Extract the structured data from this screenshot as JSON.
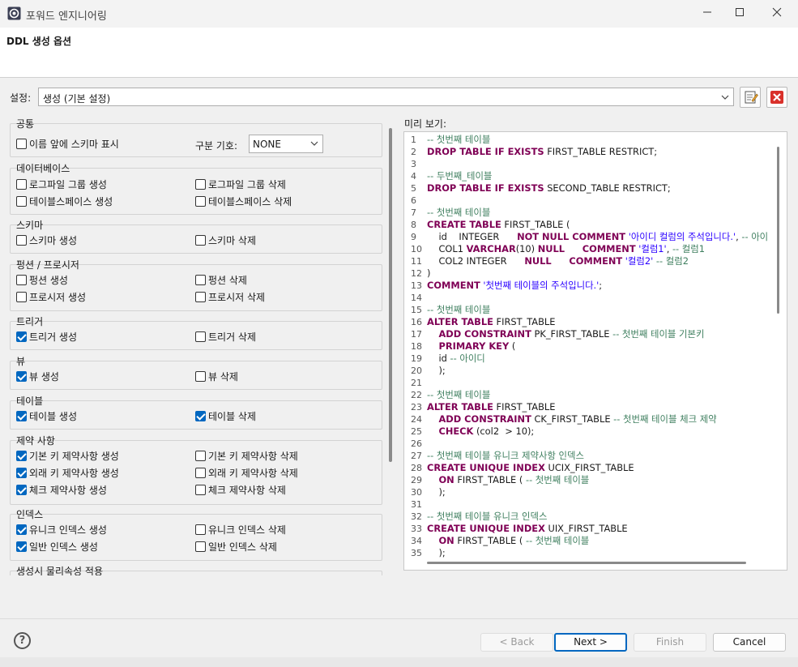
{
  "window": {
    "title": "포워드 엔지니어링",
    "minimize": "—",
    "maximize": "☐",
    "close": "✕"
  },
  "header": {
    "title": "DDL 생성 옵션"
  },
  "setting": {
    "label": "설정:",
    "value": "생성 (기본 설정)"
  },
  "options": {
    "common": {
      "title": "공통",
      "show_schema": "이름 앞에 스키마 표시",
      "show_schema_checked": false,
      "separator_label": "구분 기호:",
      "separator_value": "NONE"
    },
    "database": {
      "title": "데이터베이스",
      "items": [
        {
          "label": "로그파일 그룹 생성",
          "checked": false
        },
        {
          "label": "로그파일 그룹 삭제",
          "checked": false
        },
        {
          "label": "테이블스페이스 생성",
          "checked": false
        },
        {
          "label": "테이블스페이스 삭제",
          "checked": false
        }
      ]
    },
    "schema": {
      "title": "스키마",
      "items": [
        {
          "label": "스키마 생성",
          "checked": false
        },
        {
          "label": "스키마 삭제",
          "checked": false
        }
      ]
    },
    "function": {
      "title": "펑션 / 프로시저",
      "items": [
        {
          "label": "펑션 생성",
          "checked": false
        },
        {
          "label": "펑션 삭제",
          "checked": false
        },
        {
          "label": "프로시저 생성",
          "checked": false
        },
        {
          "label": "프로시저 삭제",
          "checked": false
        }
      ]
    },
    "trigger": {
      "title": "트리거",
      "items": [
        {
          "label": "트리거 생성",
          "checked": true
        },
        {
          "label": "트리거 삭제",
          "checked": false
        }
      ]
    },
    "view": {
      "title": "뷰",
      "items": [
        {
          "label": "뷰 생성",
          "checked": true
        },
        {
          "label": "뷰 삭제",
          "checked": false
        }
      ]
    },
    "table": {
      "title": "테이블",
      "items": [
        {
          "label": "테이블 생성",
          "checked": true
        },
        {
          "label": "테이블 삭제",
          "checked": true
        }
      ]
    },
    "constraint": {
      "title": "제약 사항",
      "items": [
        {
          "label": "기본 키 제약사항 생성",
          "checked": true
        },
        {
          "label": "기본 키 제약사항 삭제",
          "checked": false
        },
        {
          "label": "외래 키 제약사항 생성",
          "checked": true
        },
        {
          "label": "외래 키 제약사항 삭제",
          "checked": false
        },
        {
          "label": "체크 제약사항 생성",
          "checked": true
        },
        {
          "label": "체크 제약사항 삭제",
          "checked": false
        }
      ]
    },
    "index": {
      "title": "인덱스",
      "items": [
        {
          "label": "유니크 인덱스 생성",
          "checked": true
        },
        {
          "label": "유니크 인덱스 삭제",
          "checked": false
        },
        {
          "label": "일반 인덱스 생성",
          "checked": true
        },
        {
          "label": "일반 인덱스 삭제",
          "checked": false
        }
      ]
    },
    "physical": {
      "title": "생성시 물리속성 적용"
    }
  },
  "preview": {
    "label": "미리 보기:",
    "lines": [
      [
        [
          "cm",
          "-- 첫번째 테이블"
        ]
      ],
      [
        [
          "kw",
          "DROP TABLE IF EXISTS"
        ],
        [
          "tx",
          " FIRST_TABLE RESTRICT;"
        ]
      ],
      [],
      [
        [
          "cm",
          "-- 두번째_테이블"
        ]
      ],
      [
        [
          "kw",
          "DROP TABLE IF EXISTS"
        ],
        [
          "tx",
          " SECOND_TABLE RESTRICT;"
        ]
      ],
      [],
      [
        [
          "cm",
          "-- 첫번째 테이블"
        ]
      ],
      [
        [
          "kw",
          "CREATE TABLE"
        ],
        [
          "tx",
          " FIRST_TABLE ("
        ]
      ],
      [
        [
          "tx",
          "    id    INTEGER      "
        ],
        [
          "kw",
          "NOT NULL COMMENT"
        ],
        [
          "st",
          " '아이디 컬럼의 주석입니다.'"
        ],
        [
          "tx",
          ", "
        ],
        [
          "cm",
          "-- 아이"
        ]
      ],
      [
        [
          "tx",
          "    COL1 "
        ],
        [
          "kw",
          "VARCHAR"
        ],
        [
          "tx",
          "(10) "
        ],
        [
          "kw",
          "NULL"
        ],
        [
          "tx",
          "      "
        ],
        [
          "kw",
          "COMMENT"
        ],
        [
          "st",
          " '컬럼1'"
        ],
        [
          "tx",
          ", "
        ],
        [
          "cm",
          "-- 컬럼1"
        ]
      ],
      [
        [
          "tx",
          "    COL2 INTEGER      "
        ],
        [
          "kw",
          "NULL"
        ],
        [
          "tx",
          "      "
        ],
        [
          "kw",
          "COMMENT"
        ],
        [
          "st",
          " '컬럼2'"
        ],
        [
          "tx",
          " "
        ],
        [
          "cm",
          "-- 컬럼2"
        ]
      ],
      [
        [
          "tx",
          ")"
        ]
      ],
      [
        [
          "kw",
          "COMMENT"
        ],
        [
          "st",
          " '첫번째 테이블의 주석입니다.'"
        ],
        [
          "tx",
          ";"
        ]
      ],
      [],
      [
        [
          "cm",
          "-- 첫번째 테이블"
        ]
      ],
      [
        [
          "kw",
          "ALTER TABLE"
        ],
        [
          "tx",
          " FIRST_TABLE"
        ]
      ],
      [
        [
          "tx",
          "    "
        ],
        [
          "kw",
          "ADD CONSTRAINT"
        ],
        [
          "tx",
          " PK_FIRST_TABLE "
        ],
        [
          "cm",
          "-- 첫번째 테이블 기본키"
        ]
      ],
      [
        [
          "tx",
          "    "
        ],
        [
          "kw",
          "PRIMARY KEY"
        ],
        [
          "tx",
          " ("
        ]
      ],
      [
        [
          "tx",
          "    id "
        ],
        [
          "cm",
          "-- 아이디"
        ]
      ],
      [
        [
          "tx",
          "    );"
        ]
      ],
      [],
      [
        [
          "cm",
          "-- 첫번째 테이블"
        ]
      ],
      [
        [
          "kw",
          "ALTER TABLE"
        ],
        [
          "tx",
          " FIRST_TABLE"
        ]
      ],
      [
        [
          "tx",
          "    "
        ],
        [
          "kw",
          "ADD CONSTRAINT"
        ],
        [
          "tx",
          " CK_FIRST_TABLE "
        ],
        [
          "cm",
          "-- 첫번째 테이블 체크 제약"
        ]
      ],
      [
        [
          "tx",
          "    "
        ],
        [
          "kw",
          "CHECK"
        ],
        [
          "tx",
          " (col2  > 10);"
        ]
      ],
      [],
      [
        [
          "cm",
          "-- 첫번째 테이블 유니크 제약사항 인덱스"
        ]
      ],
      [
        [
          "kw",
          "CREATE UNIQUE INDEX"
        ],
        [
          "tx",
          " UCIX_FIRST_TABLE"
        ]
      ],
      [
        [
          "tx",
          "    "
        ],
        [
          "kw",
          "ON"
        ],
        [
          "tx",
          " FIRST_TABLE ( "
        ],
        [
          "cm",
          "-- 첫번째 테이블"
        ]
      ],
      [
        [
          "tx",
          "    );"
        ]
      ],
      [],
      [
        [
          "cm",
          "-- 첫번째 테이블 유니크 인덱스"
        ]
      ],
      [
        [
          "kw",
          "CREATE UNIQUE INDEX"
        ],
        [
          "tx",
          " UIX_FIRST_TABLE"
        ]
      ],
      [
        [
          "tx",
          "    "
        ],
        [
          "kw",
          "ON"
        ],
        [
          "tx",
          " FIRST_TABLE ( "
        ],
        [
          "cm",
          "-- 첫번째 테이블"
        ]
      ],
      [
        [
          "tx",
          "    );"
        ]
      ]
    ]
  },
  "buttons": {
    "help": "?",
    "back": "< Back",
    "next": "Next >",
    "finish": "Finish",
    "cancel": "Cancel"
  },
  "colors": {
    "accent": "#0067c0",
    "keyword": "#7f0055",
    "comment": "#3f7f5f",
    "string": "#2a00ff"
  }
}
